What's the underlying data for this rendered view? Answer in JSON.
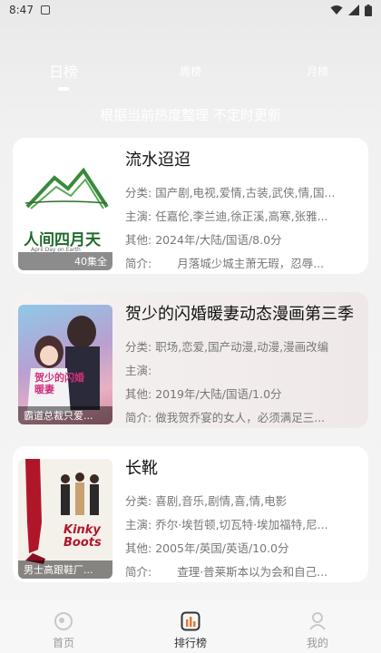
{
  "status_bar": {
    "time": "8:47"
  },
  "tabs": [
    {
      "label": "日榜",
      "active": true
    },
    {
      "label": "周榜",
      "active": false
    },
    {
      "label": "月榜",
      "active": false
    }
  ],
  "subtitle": "根据当前热度整理 不定时更新",
  "items": [
    {
      "title": "流水迢迢",
      "genre_label": "分类:",
      "genre": "国产剧,电视,爱情,古装,武侠,情,国...",
      "cast_label": "主演:",
      "cast": "任嘉伦,李兰迪,徐正溪,高寒,张雅...",
      "other_label": "其他:",
      "other": "2024年/大陆/国语/8.0分",
      "intro_label": "简介:",
      "intro": "月落城少城主萧无瑕，忍辱...",
      "poster_caption": "40集全",
      "poster_title": "人间四月天",
      "poster_sub": "April Day on Earth"
    },
    {
      "title": "贺少的闪婚暖妻动态漫画第三季",
      "genre_label": "分类:",
      "genre": "职场,恋爱,国产动漫,动漫,漫画改编",
      "cast_label": "主演:",
      "cast": "",
      "other_label": "其他:",
      "other": "2019年/大陆/国语/1.0分",
      "intro_label": "简介:",
      "intro": "做我贺乔宴的女人，必须满足三...",
      "poster_caption": "霸道总裁只爱...",
      "poster_title": "贺少的闪婚暖妻"
    },
    {
      "title": "长靴",
      "genre_label": "分类:",
      "genre": "喜剧,音乐,剧情,喜,情,电影",
      "cast_label": "主演:",
      "cast": "乔尔·埃哲顿,切瓦特·埃加福特,尼...",
      "other_label": "其他:",
      "other": "2005年/英国/英语/10.0分",
      "intro_label": "简介:",
      "intro": "查理·普莱斯本以为会和自己...",
      "poster_caption": "男士高跟鞋厂...",
      "poster_title": "Kinky Boots"
    }
  ],
  "bottom_nav": [
    {
      "label": "首页",
      "icon": "home-icon",
      "active": false
    },
    {
      "label": "排行榜",
      "icon": "ranking-icon",
      "active": true
    },
    {
      "label": "我的",
      "icon": "profile-icon",
      "active": false
    }
  ]
}
